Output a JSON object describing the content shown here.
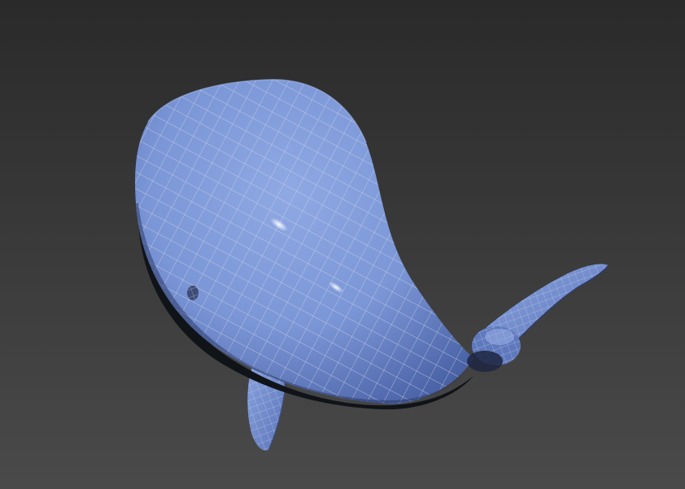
{
  "viewport": {
    "background_top": "#2a2a2a",
    "background_bottom": "#4a4a4a",
    "shading_mode": "Edged Faces"
  },
  "model": {
    "name": "whale",
    "body_color": "#7f9bd9",
    "body_highlight": "#a9c0f0",
    "body_shadow": "#3e5491",
    "wire_color": "#c9cfe0",
    "parts": [
      "body",
      "tail-fluke",
      "tail-knob",
      "pectoral-fin",
      "eye"
    ]
  }
}
